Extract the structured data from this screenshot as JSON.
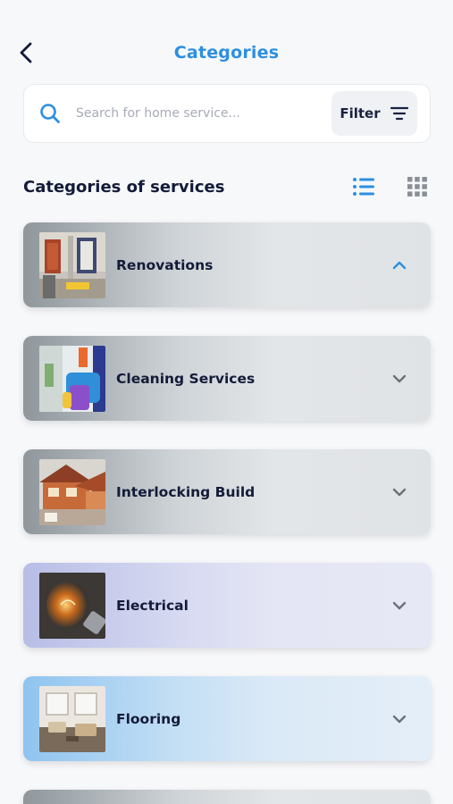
{
  "header": {
    "title": "Categories",
    "back_icon": "chevron-left-icon"
  },
  "search": {
    "placeholder": "Search for home service...",
    "value": "",
    "filter_label": "Filter"
  },
  "section": {
    "title": "Categories of services",
    "active_view": "list"
  },
  "categories": [
    {
      "label": "Renovations",
      "expanded": true,
      "icon": "chevron-up-icon"
    },
    {
      "label": "Cleaning Services",
      "expanded": false,
      "icon": "chevron-down-icon"
    },
    {
      "label": "Interlocking Build",
      "expanded": false,
      "icon": "chevron-down-icon"
    },
    {
      "label": "Electrical",
      "expanded": false,
      "icon": "chevron-down-icon"
    },
    {
      "label": "Flooring",
      "expanded": false,
      "icon": "chevron-down-icon"
    }
  ],
  "colors": {
    "accent": "#2d8fe0",
    "title_text": "#141b38",
    "chevron_down": "#6b7178"
  }
}
